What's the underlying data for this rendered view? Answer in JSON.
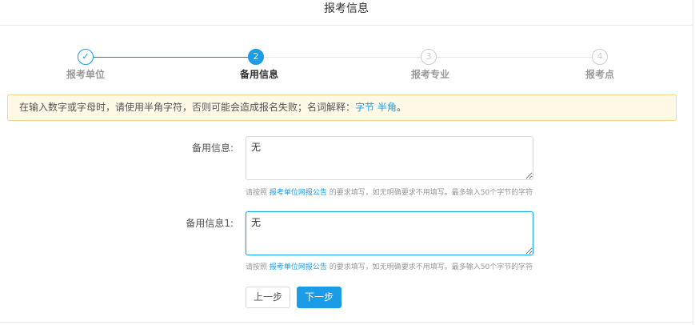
{
  "header": {
    "title": "报考信息"
  },
  "steps": [
    {
      "num": "✓",
      "label": "报考单位",
      "state": "done"
    },
    {
      "num": "2",
      "label": "备用信息",
      "state": "current"
    },
    {
      "num": "3",
      "label": "报考专业",
      "state": "pending"
    },
    {
      "num": "4",
      "label": "报考点",
      "state": "pending"
    }
  ],
  "alert": {
    "text": "在输入数字或字母时，请使用半角字符，否则可能会造成报名失败；名词解释：",
    "link1": "字节",
    "link2": "半角",
    "end": "。"
  },
  "form": {
    "field1": {
      "label": "备用信息:",
      "value": "无"
    },
    "field2": {
      "label": "备用信息1:",
      "value": "无"
    },
    "hint": {
      "pre": "请按照 ",
      "link": "报考单位网报公告",
      "post": " 的要求填写，如无明确要求不用填写。最多输入50个字节的字符"
    }
  },
  "buttons": {
    "prev": "上一步",
    "next": "下一步"
  },
  "colors": {
    "accent": "#1c9be6",
    "alert_bg": "#fef8e6"
  }
}
